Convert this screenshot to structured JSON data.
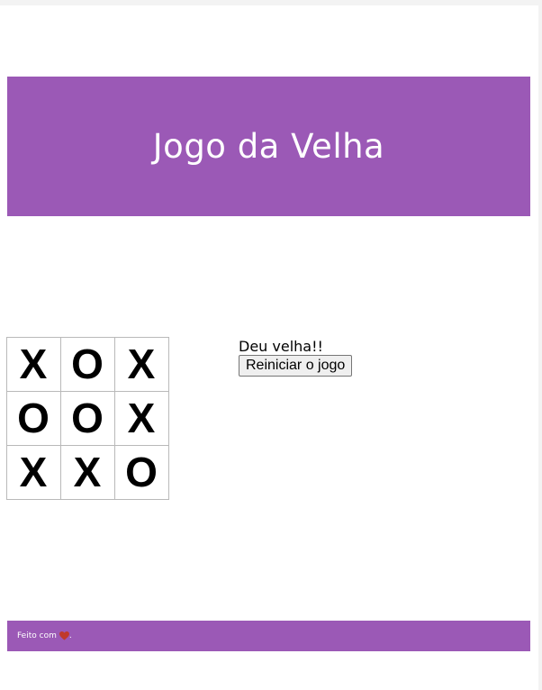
{
  "header": {
    "title": "Jogo da Velha"
  },
  "board": {
    "cells": [
      "X",
      "O",
      "X",
      "O",
      "O",
      "X",
      "X",
      "X",
      "O"
    ]
  },
  "status": {
    "message": "Deu velha!!",
    "restart_label": "Reiniciar o jogo"
  },
  "footer": {
    "made_with": "Feito com",
    "heart_icon": "heart-icon",
    "suffix": "."
  },
  "colors": {
    "accent": "#9b59b6",
    "heart": "#c0392b"
  }
}
